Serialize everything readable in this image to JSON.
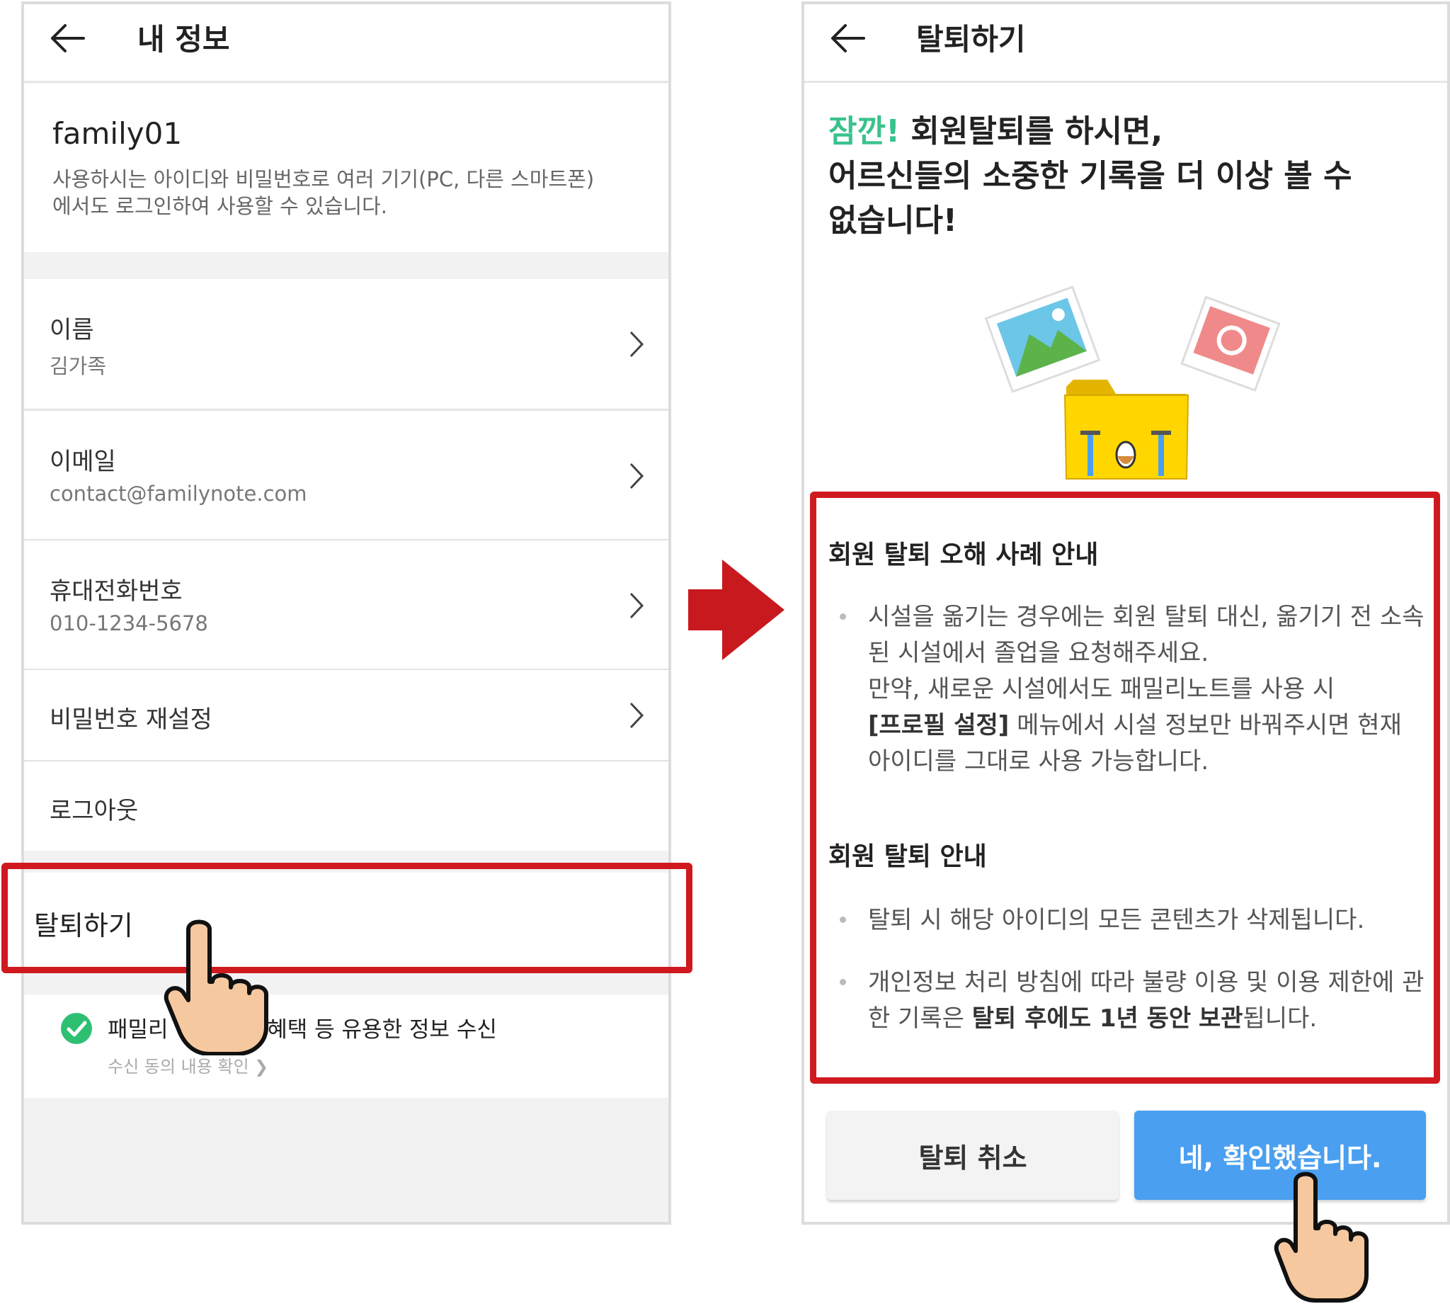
{
  "left_screen": {
    "title": "내 정보",
    "username": "family01",
    "profile_desc": "사용하시는 아이디와 비밀번호로 여러 기기(PC, 다른 스마트폰)에서도 로그인하여 사용할 수 있습니다.",
    "rows": [
      {
        "label": "이름",
        "value": "김가족"
      },
      {
        "label": "이메일",
        "value": "contact@familynote.com"
      },
      {
        "label": "휴대전화번호",
        "value": "010-1234-5678"
      },
      {
        "label": "비밀번호 재설정"
      },
      {
        "label": "로그아웃"
      }
    ],
    "withdraw_label": "탈퇴하기",
    "consent_text_a": "패밀리",
    "consent_text_b": ", 혜택 등 유용한 정보 수신",
    "consent_link": "수신 동의 내용 확인"
  },
  "right_screen": {
    "title": "탈퇴하기",
    "headline_accent": "잠깐!",
    "headline_rest": "회원탈퇴를 하시면,",
    "headline_line2": "어르신들의 소중한 기록을 더 이상 볼 수",
    "headline_line3": "없습니다!",
    "section1_title": "회원 탈퇴 오해 사례 안내",
    "section1_p1": "시설을 옮기는 경우에는 회원 탈퇴 대신, 옮기기 전 소속된 시설에서 졸업을 요청해주세요.",
    "section1_p2a": "만약, 새로운 시설에서도 패밀리노트를 사용 시",
    "section1_p2_bold": "[프로필 설정]",
    "section1_p2b": "메뉴에서 시설 정보만 바꿔주시면 현재 아이디를 그대로 사용 가능합니다.",
    "section2_title": "회원 탈퇴 안내",
    "section2_b1": "탈퇴 시 해당 아이디의 모든 콘텐츠가 삭제됩니다.",
    "section2_b2a": "개인정보 처리 방침에 따라 불량 이용 및 이용 제한에 관한 기록은",
    "section2_b2_bold1": "탈퇴 후에도 1년 동안",
    "section2_b2_bold2": "보관",
    "section2_b2c": "됩니다.",
    "cancel_label": "탈퇴 취소",
    "confirm_label": "네, 확인했습니다."
  },
  "colors": {
    "highlight_red": "#d0191f",
    "accent_green": "#39c28c",
    "confirm_blue": "#4a9ff0",
    "arrow_red": "#c8191f"
  },
  "icons": [
    "back-arrow-icon",
    "chevron-right-icon",
    "check-circle-icon",
    "pointing-hand-icon",
    "right-arrow-icon",
    "photo-icon",
    "camera-photo-icon",
    "folder-icon"
  ]
}
